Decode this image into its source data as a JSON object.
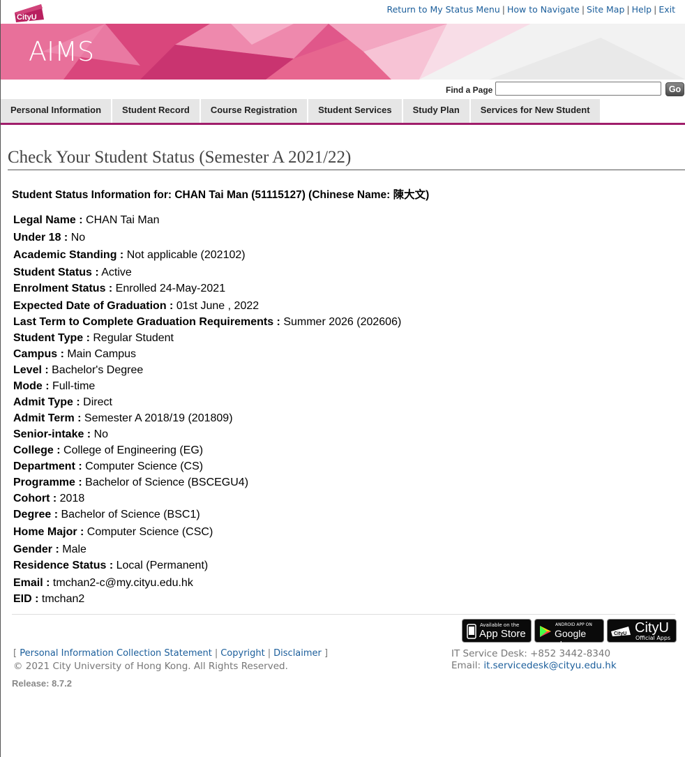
{
  "header": {
    "logo_text": "CityU",
    "links": [
      "Return to My Status Menu",
      "How to Navigate",
      "Site Map",
      "Help",
      "Exit"
    ],
    "banner_title": "AIMS",
    "find_label": "Find a Page",
    "find_value": "",
    "go_label": "Go"
  },
  "nav": [
    "Personal Information",
    "Student Record",
    "Course Registration",
    "Student Services",
    "Study Plan",
    "Services for New Student"
  ],
  "page": {
    "title": "Check Your Student Status (Semester A 2021/22)",
    "info_heading": "Student Status Information for: CHAN Tai Man (51115127) (Chinese Name: 陳大文)"
  },
  "fields": [
    {
      "label": "Legal Name :",
      "value": " CHAN Tai Man"
    },
    {
      "label": "Under 18 :",
      "value": " No"
    },
    {
      "label": "Academic Standing :",
      "value": " Not applicable (202102)"
    },
    {
      "label": "Student Status :",
      "value": " Active"
    },
    {
      "label": "Enrolment Status :",
      "value": " Enrolled 24-May-2021"
    },
    {
      "label": "Expected Date of Graduation :",
      "value": " 01st June , 2022"
    },
    {
      "label": "Last Term to Complete Graduation Requirements :",
      "value": " Summer 2026 (202606)"
    },
    {
      "label": "Student Type :",
      "value": " Regular Student"
    },
    {
      "label": "Campus :",
      "value": " Main Campus"
    },
    {
      "label": "Level :",
      "value": " Bachelor's Degree"
    },
    {
      "label": "Mode :",
      "value": " Full-time"
    },
    {
      "label": "Admit Type :",
      "value": " Direct"
    },
    {
      "label": "Admit Term :",
      "value": " Semester A 2018/19 (201809)"
    },
    {
      "label": "Senior-intake :",
      "value": " No"
    },
    {
      "label": "College :",
      "value": " College of Engineering (EG)"
    },
    {
      "label": "Department :",
      "value": " Computer Science (CS)"
    },
    {
      "label": "Programme :",
      "value": " Bachelor of Science (BSCEGU4)"
    },
    {
      "label": "Cohort :",
      "value": " 2018"
    },
    {
      "label": "Degree :",
      "value": " Bachelor of Science (BSC1)"
    },
    {
      "label": "Home Major :",
      "value": " Computer Science (CSC)"
    },
    {
      "label": "Gender :",
      "value": " Male"
    },
    {
      "label": "Residence Status :",
      "value": " Local (Permanent)"
    },
    {
      "label": "Email :",
      "value": " tmchan2-c@my.cityu.edu.hk"
    },
    {
      "label": "EID :",
      "value": " tmchan2"
    }
  ],
  "badges": {
    "appstore_small": "Available on the",
    "appstore_large": "App Store",
    "google_small": "ANDROID APP ON",
    "google_large": "Google play",
    "cityu_large": "CityU",
    "cityu_small": "Official Apps",
    "cityu_logo": "CityU"
  },
  "footer": {
    "links": [
      "Personal Information Collection Statement",
      "Copyright",
      "Disclaimer"
    ],
    "copyright": "© 2021 City University of Hong Kong. All Rights Reserved.",
    "release": "Release: 8.7.2",
    "desk_label": "IT Service Desk: +852 3442-8340",
    "email_label": "Email:",
    "email": "it.servicedesk@cityu.edu.hk"
  },
  "colors": {
    "brand": "#a01e6b",
    "link": "#1b5e9b",
    "banner_pink": "#e04b82"
  }
}
